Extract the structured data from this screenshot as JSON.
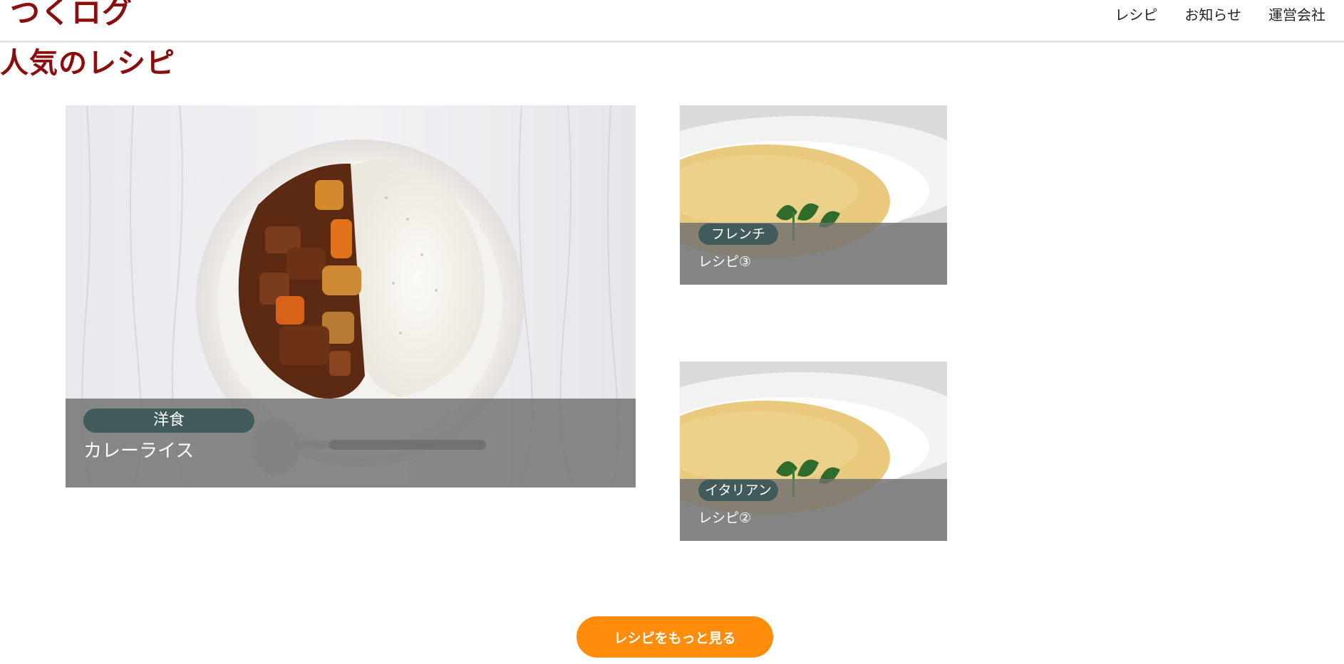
{
  "header": {
    "logo": "つくログ",
    "nav": [
      {
        "label": "レシピ"
      },
      {
        "label": "お知らせ"
      },
      {
        "label": "運営会社"
      }
    ]
  },
  "main": {
    "section_title": "人気のレシピ",
    "cards": [
      {
        "tag": "洋食",
        "title": "カレーライス",
        "image": "curry-rice-photo"
      },
      {
        "tag": "フレンチ",
        "title": "レシピ③",
        "image": "soup-bowl-photo"
      },
      {
        "tag": "イタリアン",
        "title": "レシピ②",
        "image": "soup-bowl-photo"
      }
    ],
    "more_button": "レシピをもっと見る"
  }
}
